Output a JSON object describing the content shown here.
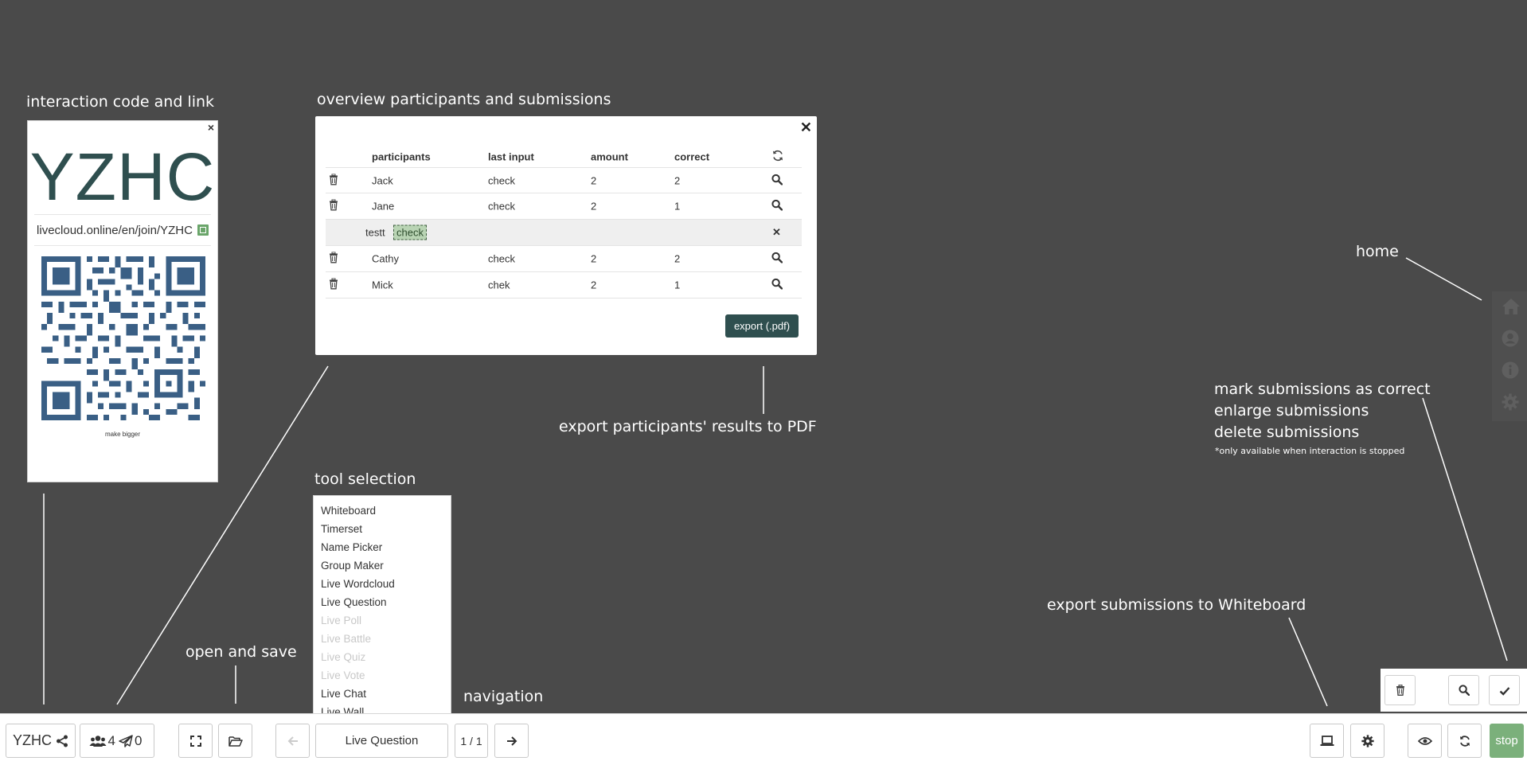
{
  "annotations": {
    "code_link": "interaction code and link",
    "overview": "overview participants and submissions",
    "export_pdf": "export participants' results to PDF",
    "tool_selection": "tool selection",
    "open_save": "open and save",
    "navigation": "navigation",
    "home": "home",
    "mark_correct": "mark submissions as correct",
    "enlarge": "enlarge submissions",
    "delete": "delete submissions",
    "stopped_note": "*only available when interaction is stopped",
    "export_whiteboard": "export submissions to Whiteboard"
  },
  "code_card": {
    "close": "×",
    "code": "YZHC",
    "link": "livecloud.online/en/join/YZHC",
    "bigger": "make bigger"
  },
  "overview": {
    "close": "✕",
    "headers": {
      "participants": "participants",
      "last_input": "last input",
      "amount": "amount",
      "correct": "correct"
    },
    "rows": [
      {
        "name": "Jack",
        "last": "check",
        "amount": "2",
        "correct": "2"
      },
      {
        "name": "Jane",
        "last": "check",
        "amount": "2",
        "correct": "1"
      },
      {
        "name": "Cathy",
        "last": "check",
        "amount": "2",
        "correct": "2"
      },
      {
        "name": "Mick",
        "last": "chek",
        "amount": "2",
        "correct": "1"
      }
    ],
    "editing": {
      "name": "testt",
      "value": "check",
      "close": "✕"
    },
    "export_label": "export (.pdf)"
  },
  "tools": {
    "items": [
      {
        "label": "Whiteboard",
        "enabled": true
      },
      {
        "label": "Timerset",
        "enabled": true
      },
      {
        "label": "Name Picker",
        "enabled": true
      },
      {
        "label": "Group Maker",
        "enabled": true
      },
      {
        "label": "Live Wordcloud",
        "enabled": true
      },
      {
        "label": "Live Question",
        "enabled": true
      },
      {
        "label": "Live Poll",
        "enabled": false
      },
      {
        "label": "Live Battle",
        "enabled": false
      },
      {
        "label": "Live Quiz",
        "enabled": false
      },
      {
        "label": "Live Vote",
        "enabled": false
      },
      {
        "label": "Live Chat",
        "enabled": true
      },
      {
        "label": "Live Wall",
        "enabled": true
      }
    ]
  },
  "toolbar": {
    "code": "YZHC",
    "participants_count": "4",
    "submissions_count": "0",
    "current_tool": "Live Question",
    "page": "1 / 1",
    "stop": "stop"
  },
  "icons": {
    "share": "share-icon",
    "users": "users-icon",
    "send": "paper-plane-icon",
    "fullscreen": "expand-icon",
    "folder": "folder-open-icon",
    "prev": "arrow-left-icon",
    "next": "arrow-right-icon",
    "laptop": "laptop-icon",
    "gear": "gear-icon",
    "eye": "eye-icon",
    "refresh": "refresh-icon",
    "trash": "trash-icon",
    "search": "search-icon",
    "check": "check-icon",
    "home": "home-icon",
    "user": "user-circle-icon",
    "info": "info-icon"
  },
  "colors": {
    "background": "#4a4a4a",
    "accent_dark": "#2f4f4f",
    "qr": "#3a5f85",
    "stop_green": "#7bb07b",
    "copy_green": "#6aa56a"
  }
}
